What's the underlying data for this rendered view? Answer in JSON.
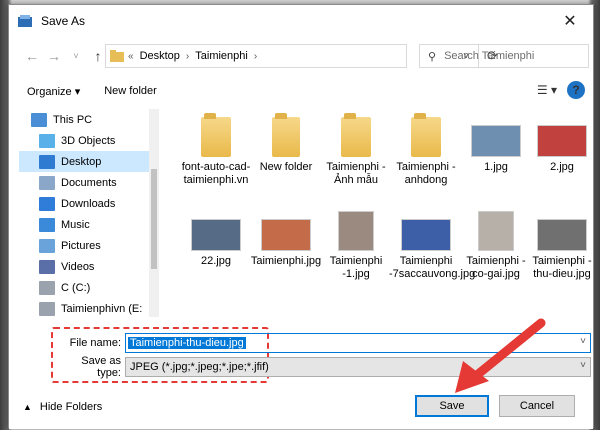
{
  "window": {
    "title": "Save As"
  },
  "address": {
    "breadcrumbs": [
      "Desktop",
      "Taimienphi"
    ],
    "prefix": "«"
  },
  "search": {
    "placeholder": "Search Taimienphi"
  },
  "toolbar": {
    "organize": "Organize ▾",
    "new_folder": "New folder"
  },
  "sidebar": {
    "items": [
      {
        "label": "This PC",
        "icon": "pc-icon",
        "color": "#4a8fd6"
      },
      {
        "label": "3D Objects",
        "icon": "cube-icon",
        "color": "#5ab0e8"
      },
      {
        "label": "Desktop",
        "icon": "desktop-icon",
        "color": "#2e7bd1"
      },
      {
        "label": "Documents",
        "icon": "document-icon",
        "color": "#8aa6c8"
      },
      {
        "label": "Downloads",
        "icon": "download-icon",
        "color": "#2f7dd8"
      },
      {
        "label": "Music",
        "icon": "music-icon",
        "color": "#3a8ad9"
      },
      {
        "label": "Pictures",
        "icon": "pictures-icon",
        "color": "#6aa3d9"
      },
      {
        "label": "Videos",
        "icon": "video-icon",
        "color": "#5a6fa8"
      },
      {
        "label": "C (C:)",
        "icon": "drive-icon",
        "color": "#9aa3ad"
      },
      {
        "label": "Taimienphivn (E:",
        "icon": "drive-icon",
        "color": "#9aa3ad"
      }
    ]
  },
  "files": [
    {
      "name": "font-auto-cad-taimienphi.vn",
      "kind": "folder"
    },
    {
      "name": "New folder",
      "kind": "folder-plain"
    },
    {
      "name": "Taimienphi - Ảnh mẫu",
      "kind": "folder"
    },
    {
      "name": "Taimienphi -anhdong",
      "kind": "folder"
    },
    {
      "name": "1.jpg",
      "kind": "photo",
      "color": "#6f8fb0"
    },
    {
      "name": "2.jpg",
      "kind": "photo",
      "color": "#c0413d"
    },
    {
      "name": "22.jpg",
      "kind": "photo",
      "color": "#566b85"
    },
    {
      "name": "Taimienphi.jpg",
      "kind": "photo",
      "color": "#c46b4a"
    },
    {
      "name": "Taimienphi -1.jpg",
      "kind": "photo-tall",
      "color": "#9a8a80"
    },
    {
      "name": "Taimienphi -7saccauvong.jpg",
      "kind": "photo",
      "color": "#3d5fa8"
    },
    {
      "name": "Taimienphi -co-gai.jpg",
      "kind": "photo-tall",
      "color": "#b7b0a8"
    },
    {
      "name": "Taimienphi -thu-dieu.jpg",
      "kind": "photo",
      "color": "#707070"
    }
  ],
  "form": {
    "file_name_label": "File name:",
    "file_name_value": "Taimienphi-thu-dieu.jpg",
    "type_label": "Save as type:",
    "type_value": "JPEG (*.jpg;*.jpeg;*.jpe;*.jfif)"
  },
  "footer": {
    "hide_folders": "Hide Folders",
    "save": "Save",
    "cancel": "Cancel"
  },
  "colors": {
    "accent": "#0078d7",
    "annotation": "#e53935"
  }
}
